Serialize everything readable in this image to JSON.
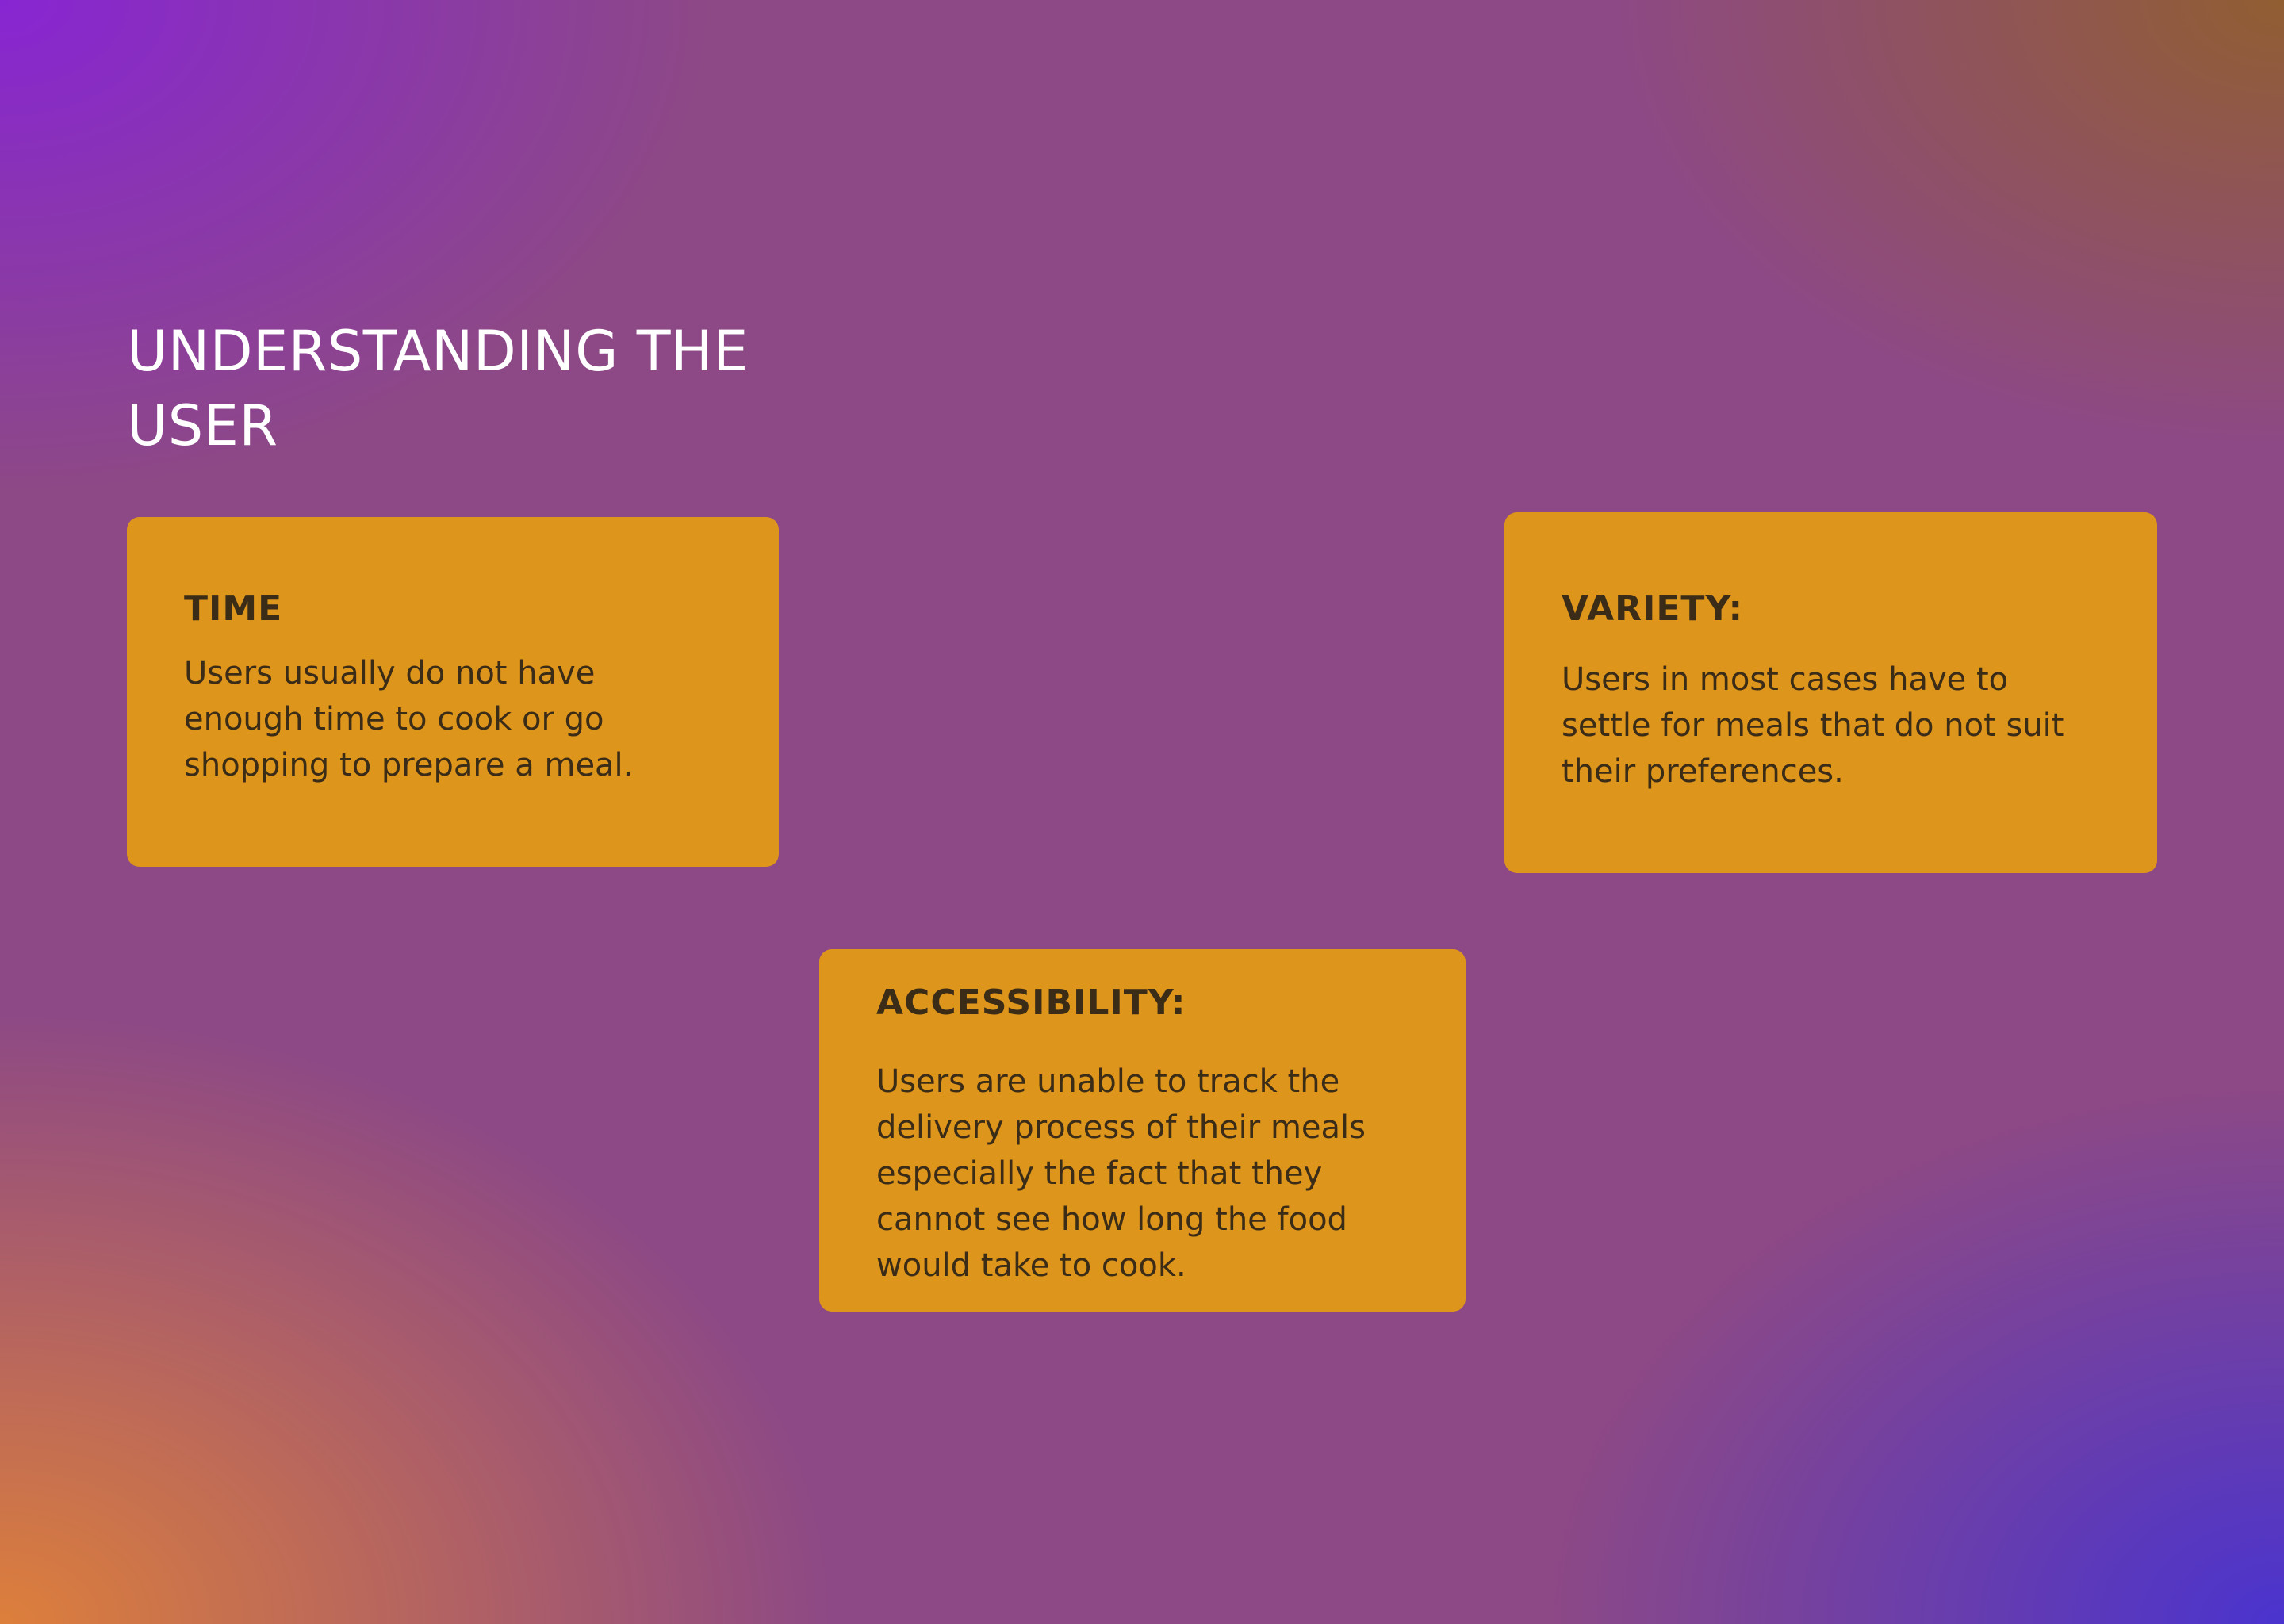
{
  "slide": {
    "title": "UNDERSTANDING THE USER"
  },
  "cards": [
    {
      "heading": "TIME",
      "body": "Users usually do not have enough time to cook or go shopping to prepare a meal."
    },
    {
      "heading": "VARIETY:",
      "body": "Users in most cases have to settle for meals that do not suit their preferences."
    },
    {
      "heading": "ACCESSIBILITY:",
      "body": "Users are unable to track the delivery process of their meals especially the fact that they cannot see how long the food would take to cook."
    }
  ],
  "colors": {
    "card_background": "#de951b",
    "card_text": "#3a2c17",
    "title_text": "#ffffff"
  }
}
